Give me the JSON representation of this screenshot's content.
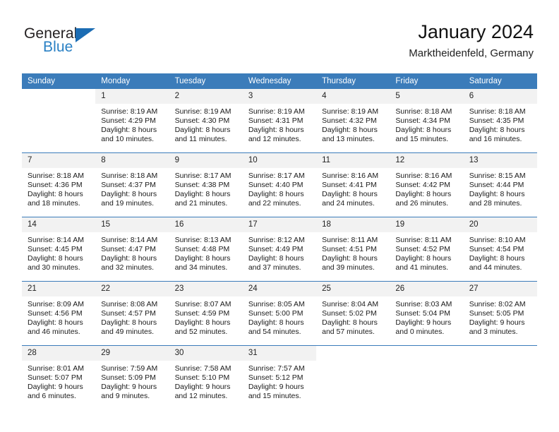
{
  "brand": {
    "name_top": "General",
    "name_bottom": "Blue",
    "triangle_color": "#1b6cb3",
    "blue_color": "#2980c4"
  },
  "header": {
    "title": "January 2024",
    "subtitle": "Marktheidenfeld, Germany"
  },
  "colors": {
    "header_row": "#3b7cba",
    "daynum_bg": "#f2f2f2",
    "grid_line": "#3b7cba"
  },
  "weekday_headers": [
    "Sunday",
    "Monday",
    "Tuesday",
    "Wednesday",
    "Thursday",
    "Friday",
    "Saturday"
  ],
  "weeks": [
    [
      {
        "day": "",
        "blank": true,
        "sunrise": "",
        "sunset": "",
        "daylight_1": "",
        "daylight_2": ""
      },
      {
        "day": "1",
        "sunrise": "Sunrise: 8:19 AM",
        "sunset": "Sunset: 4:29 PM",
        "daylight_1": "Daylight: 8 hours",
        "daylight_2": "and 10 minutes."
      },
      {
        "day": "2",
        "sunrise": "Sunrise: 8:19 AM",
        "sunset": "Sunset: 4:30 PM",
        "daylight_1": "Daylight: 8 hours",
        "daylight_2": "and 11 minutes."
      },
      {
        "day": "3",
        "sunrise": "Sunrise: 8:19 AM",
        "sunset": "Sunset: 4:31 PM",
        "daylight_1": "Daylight: 8 hours",
        "daylight_2": "and 12 minutes."
      },
      {
        "day": "4",
        "sunrise": "Sunrise: 8:19 AM",
        "sunset": "Sunset: 4:32 PM",
        "daylight_1": "Daylight: 8 hours",
        "daylight_2": "and 13 minutes."
      },
      {
        "day": "5",
        "sunrise": "Sunrise: 8:18 AM",
        "sunset": "Sunset: 4:34 PM",
        "daylight_1": "Daylight: 8 hours",
        "daylight_2": "and 15 minutes."
      },
      {
        "day": "6",
        "sunrise": "Sunrise: 8:18 AM",
        "sunset": "Sunset: 4:35 PM",
        "daylight_1": "Daylight: 8 hours",
        "daylight_2": "and 16 minutes."
      }
    ],
    [
      {
        "day": "7",
        "sunrise": "Sunrise: 8:18 AM",
        "sunset": "Sunset: 4:36 PM",
        "daylight_1": "Daylight: 8 hours",
        "daylight_2": "and 18 minutes."
      },
      {
        "day": "8",
        "sunrise": "Sunrise: 8:18 AM",
        "sunset": "Sunset: 4:37 PM",
        "daylight_1": "Daylight: 8 hours",
        "daylight_2": "and 19 minutes."
      },
      {
        "day": "9",
        "sunrise": "Sunrise: 8:17 AM",
        "sunset": "Sunset: 4:38 PM",
        "daylight_1": "Daylight: 8 hours",
        "daylight_2": "and 21 minutes."
      },
      {
        "day": "10",
        "sunrise": "Sunrise: 8:17 AM",
        "sunset": "Sunset: 4:40 PM",
        "daylight_1": "Daylight: 8 hours",
        "daylight_2": "and 22 minutes."
      },
      {
        "day": "11",
        "sunrise": "Sunrise: 8:16 AM",
        "sunset": "Sunset: 4:41 PM",
        "daylight_1": "Daylight: 8 hours",
        "daylight_2": "and 24 minutes."
      },
      {
        "day": "12",
        "sunrise": "Sunrise: 8:16 AM",
        "sunset": "Sunset: 4:42 PM",
        "daylight_1": "Daylight: 8 hours",
        "daylight_2": "and 26 minutes."
      },
      {
        "day": "13",
        "sunrise": "Sunrise: 8:15 AM",
        "sunset": "Sunset: 4:44 PM",
        "daylight_1": "Daylight: 8 hours",
        "daylight_2": "and 28 minutes."
      }
    ],
    [
      {
        "day": "14",
        "sunrise": "Sunrise: 8:14 AM",
        "sunset": "Sunset: 4:45 PM",
        "daylight_1": "Daylight: 8 hours",
        "daylight_2": "and 30 minutes."
      },
      {
        "day": "15",
        "sunrise": "Sunrise: 8:14 AM",
        "sunset": "Sunset: 4:47 PM",
        "daylight_1": "Daylight: 8 hours",
        "daylight_2": "and 32 minutes."
      },
      {
        "day": "16",
        "sunrise": "Sunrise: 8:13 AM",
        "sunset": "Sunset: 4:48 PM",
        "daylight_1": "Daylight: 8 hours",
        "daylight_2": "and 34 minutes."
      },
      {
        "day": "17",
        "sunrise": "Sunrise: 8:12 AM",
        "sunset": "Sunset: 4:49 PM",
        "daylight_1": "Daylight: 8 hours",
        "daylight_2": "and 37 minutes."
      },
      {
        "day": "18",
        "sunrise": "Sunrise: 8:11 AM",
        "sunset": "Sunset: 4:51 PM",
        "daylight_1": "Daylight: 8 hours",
        "daylight_2": "and 39 minutes."
      },
      {
        "day": "19",
        "sunrise": "Sunrise: 8:11 AM",
        "sunset": "Sunset: 4:52 PM",
        "daylight_1": "Daylight: 8 hours",
        "daylight_2": "and 41 minutes."
      },
      {
        "day": "20",
        "sunrise": "Sunrise: 8:10 AM",
        "sunset": "Sunset: 4:54 PM",
        "daylight_1": "Daylight: 8 hours",
        "daylight_2": "and 44 minutes."
      }
    ],
    [
      {
        "day": "21",
        "sunrise": "Sunrise: 8:09 AM",
        "sunset": "Sunset: 4:56 PM",
        "daylight_1": "Daylight: 8 hours",
        "daylight_2": "and 46 minutes."
      },
      {
        "day": "22",
        "sunrise": "Sunrise: 8:08 AM",
        "sunset": "Sunset: 4:57 PM",
        "daylight_1": "Daylight: 8 hours",
        "daylight_2": "and 49 minutes."
      },
      {
        "day": "23",
        "sunrise": "Sunrise: 8:07 AM",
        "sunset": "Sunset: 4:59 PM",
        "daylight_1": "Daylight: 8 hours",
        "daylight_2": "and 52 minutes."
      },
      {
        "day": "24",
        "sunrise": "Sunrise: 8:05 AM",
        "sunset": "Sunset: 5:00 PM",
        "daylight_1": "Daylight: 8 hours",
        "daylight_2": "and 54 minutes."
      },
      {
        "day": "25",
        "sunrise": "Sunrise: 8:04 AM",
        "sunset": "Sunset: 5:02 PM",
        "daylight_1": "Daylight: 8 hours",
        "daylight_2": "and 57 minutes."
      },
      {
        "day": "26",
        "sunrise": "Sunrise: 8:03 AM",
        "sunset": "Sunset: 5:04 PM",
        "daylight_1": "Daylight: 9 hours",
        "daylight_2": "and 0 minutes."
      },
      {
        "day": "27",
        "sunrise": "Sunrise: 8:02 AM",
        "sunset": "Sunset: 5:05 PM",
        "daylight_1": "Daylight: 9 hours",
        "daylight_2": "and 3 minutes."
      }
    ],
    [
      {
        "day": "28",
        "sunrise": "Sunrise: 8:01 AM",
        "sunset": "Sunset: 5:07 PM",
        "daylight_1": "Daylight: 9 hours",
        "daylight_2": "and 6 minutes."
      },
      {
        "day": "29",
        "sunrise": "Sunrise: 7:59 AM",
        "sunset": "Sunset: 5:09 PM",
        "daylight_1": "Daylight: 9 hours",
        "daylight_2": "and 9 minutes."
      },
      {
        "day": "30",
        "sunrise": "Sunrise: 7:58 AM",
        "sunset": "Sunset: 5:10 PM",
        "daylight_1": "Daylight: 9 hours",
        "daylight_2": "and 12 minutes."
      },
      {
        "day": "31",
        "sunrise": "Sunrise: 7:57 AM",
        "sunset": "Sunset: 5:12 PM",
        "daylight_1": "Daylight: 9 hours",
        "daylight_2": "and 15 minutes."
      },
      {
        "day": "",
        "blank": true,
        "sunrise": "",
        "sunset": "",
        "daylight_1": "",
        "daylight_2": ""
      },
      {
        "day": "",
        "blank": true,
        "sunrise": "",
        "sunset": "",
        "daylight_1": "",
        "daylight_2": ""
      },
      {
        "day": "",
        "blank": true,
        "sunrise": "",
        "sunset": "",
        "daylight_1": "",
        "daylight_2": ""
      }
    ]
  ]
}
